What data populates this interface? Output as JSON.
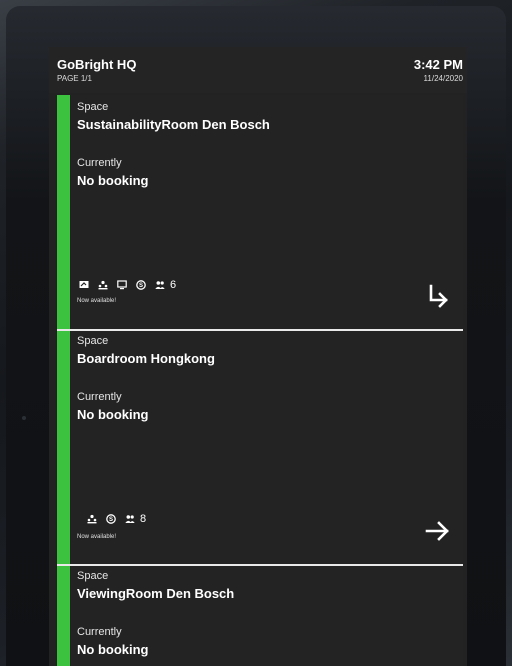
{
  "header": {
    "title": "GoBright HQ",
    "page": "PAGE 1/1",
    "time": "3:42 PM",
    "date": "11/24/2020"
  },
  "colors": {
    "available": "#3cc23f",
    "card_bg": "#232323",
    "separator": "#e9e9e9"
  },
  "rooms": [
    {
      "space_label": "Space",
      "name": "SustainabilityRoom Den Bosch",
      "currently_label": "Currently",
      "status": "No booking",
      "capacity": "6",
      "availability": "Now available!",
      "icons": [
        "whiteboard-icon",
        "video-conference-icon",
        "screen-icon",
        "skype-icon",
        "people-icon"
      ],
      "action_icon": "arrow-down-right-icon"
    },
    {
      "space_label": "Space",
      "name": "Boardroom Hongkong",
      "currently_label": "Currently",
      "status": "No booking",
      "capacity": "8",
      "availability": "Now available!",
      "icons": [
        "video-conference-icon",
        "skype-icon",
        "people-icon"
      ],
      "action_icon": "arrow-right-icon"
    },
    {
      "space_label": "Space",
      "name": "ViewingRoom Den Bosch",
      "currently_label": "Currently",
      "status": "No booking"
    }
  ]
}
